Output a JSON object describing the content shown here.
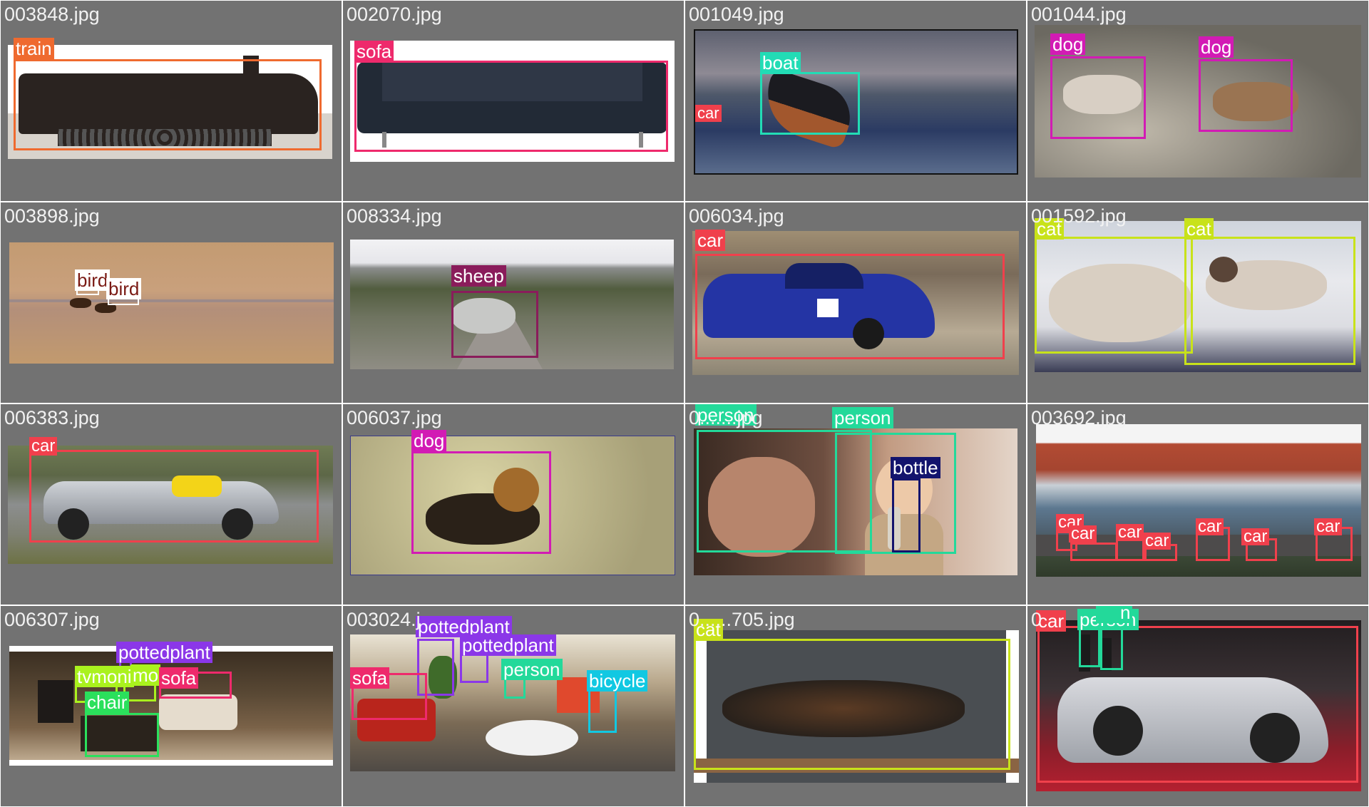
{
  "colors": {
    "background": "#727272",
    "filename_text": "#f2f2f2",
    "train": "#ef6a2f",
    "sofa": "#ee2a6c",
    "boat": "#22dcb5",
    "dog": "#d21bb4",
    "bird": "#7a1a14",
    "sheep": "#8a1c5b",
    "car": "#f0404c",
    "cat": "#c8e21a",
    "person": "#23d99a",
    "bottle": "#13146d",
    "pottedplant": "#8b37e8",
    "tvmonitor": "#aaf21e",
    "chair": "#2be05c",
    "bicycle": "#11c8e2"
  },
  "tiles": [
    {
      "filename": "003848.jpg",
      "labels": [
        "train"
      ]
    },
    {
      "filename": "002070.jpg",
      "labels": [
        "sofa"
      ]
    },
    {
      "filename": "001049.jpg",
      "labels": [
        "boat",
        "car"
      ]
    },
    {
      "filename": "001044.jpg",
      "labels": [
        "dog",
        "dog"
      ]
    },
    {
      "filename": "003898.jpg",
      "labels": [
        "bird",
        "bird"
      ]
    },
    {
      "filename": "008334.jpg",
      "labels": [
        "sheep"
      ]
    },
    {
      "filename": "006034.jpg",
      "labels": [
        "car"
      ]
    },
    {
      "filename": "001592.jpg",
      "labels": [
        "cat",
        "cat"
      ]
    },
    {
      "filename": "006383.jpg",
      "labels": [
        "car"
      ]
    },
    {
      "filename": "006037.jpg",
      "labels": [
        "dog"
      ]
    },
    {
      "filename": "0",
      "filename_suffix": "jpg",
      "labels": [
        "person",
        "person",
        "bottle"
      ]
    },
    {
      "filename": "003692.jpg",
      "labels": [
        "car",
        "car",
        "car",
        "car",
        "car",
        "car",
        "car"
      ]
    },
    {
      "filename": "006307.jpg",
      "labels": [
        "pottedplant",
        "tvmoni",
        "mo",
        "sofa",
        "chair"
      ]
    },
    {
      "filename": "003024.j",
      "labels": [
        "pottedplant",
        "pottedplant",
        "sofa",
        "person",
        "bicycle"
      ]
    },
    {
      "filename": "0",
      "filename_suffix": "705.jpg",
      "labels": [
        "cat"
      ]
    },
    {
      "filename": "0",
      "labels": [
        "car",
        "person",
        "n"
      ]
    }
  ]
}
